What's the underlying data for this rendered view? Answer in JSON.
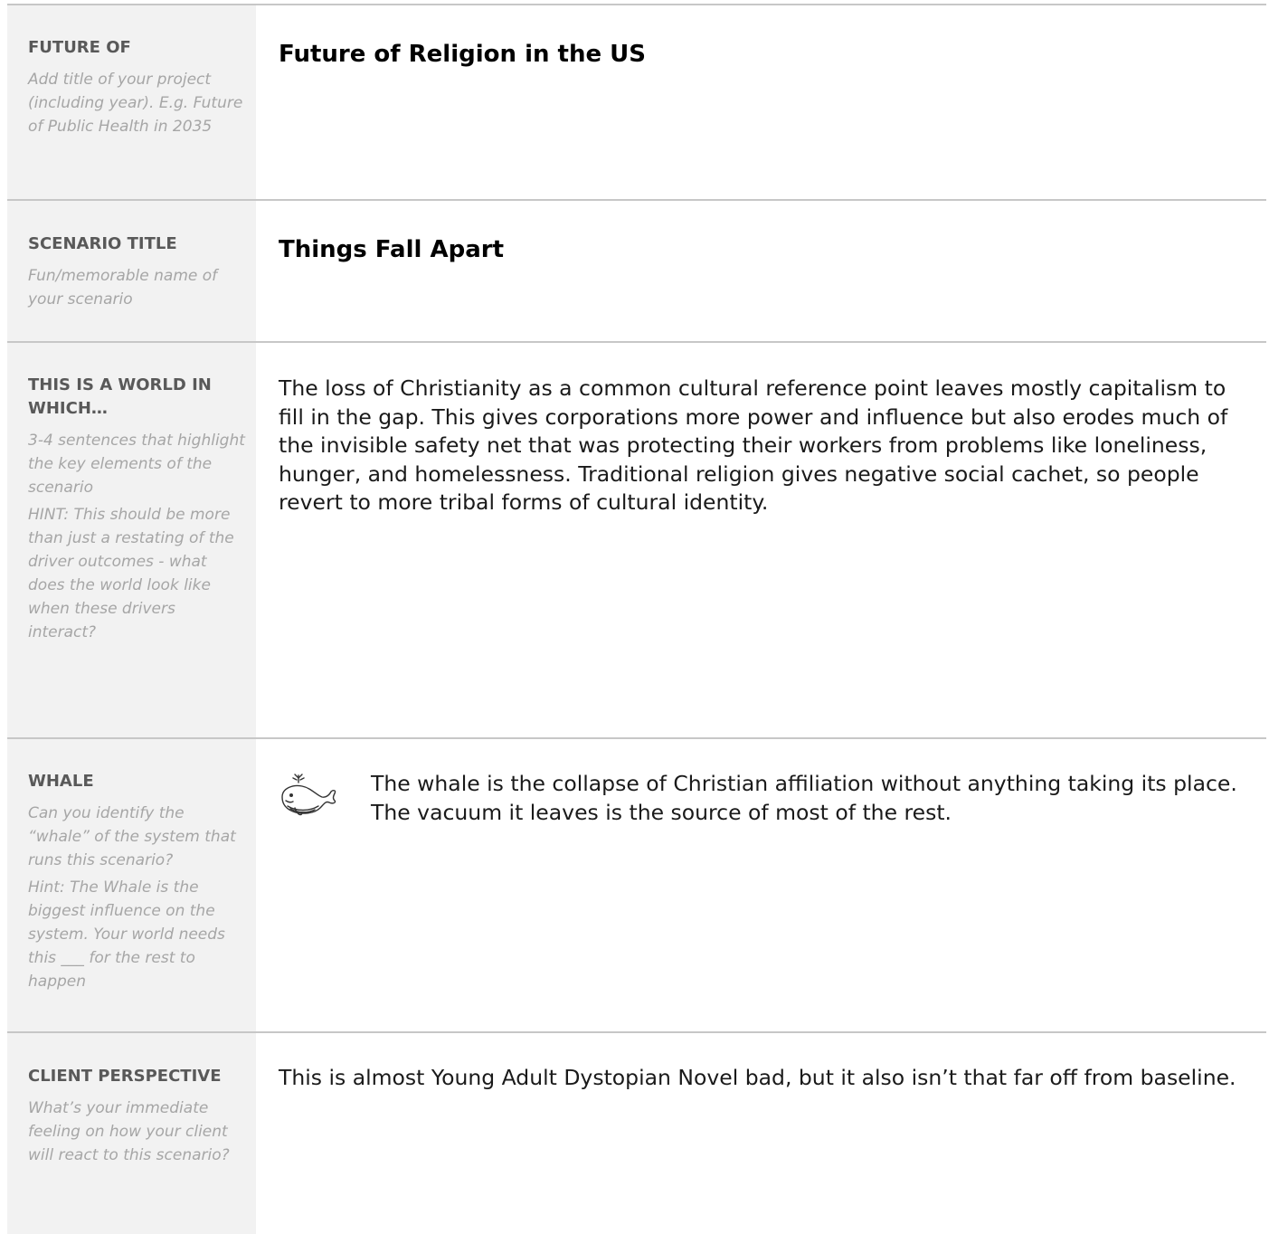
{
  "rows": [
    {
      "label": "FUTURE OF",
      "hints": [
        "Add title of your project (including year). E.g. Future of Public Health in 2035"
      ],
      "content": "Future of Religion in the US"
    },
    {
      "label": "SCENARIO TITLE",
      "hints": [
        "Fun/memorable name of your scenario"
      ],
      "content": "Things Fall Apart"
    },
    {
      "label": "THIS IS A WORLD IN WHICH…",
      "hints": [
        "3-4 sentences that highlight the key elements of the scenario",
        "HINT: This should be more than just a restating of the driver outcomes - what does the world look like when these drivers interact?"
      ],
      "content": "The loss of Christianity as a common cultural reference point leaves mostly capitalism to fill in the gap. This gives corporations more power and influence but also erodes much of the invisible safety net that was protecting their workers from problems like loneliness, hunger, and homelessness. Traditional religion gives negative social cachet, so people revert to more tribal forms of cultural identity."
    },
    {
      "label": "WHALE",
      "hints": [
        "Can you identify the “whale” of the system that runs this scenario?",
        " Hint: The Whale is the biggest influence on the system. Your world needs this ___ for the rest to happen"
      ],
      "icon": "whale-icon",
      "content": "The whale is the collapse of Christian affiliation without anything taking its place. The vacuum it leaves is the source of most of the rest."
    },
    {
      "label": "CLIENT PERSPECTIVE",
      "hints": [
        "What’s your immediate feeling on how your client will react to this scenario?"
      ],
      "content": "This is almost Young Adult Dystopian Novel bad, but it also isn’t that far off from baseline."
    }
  ]
}
